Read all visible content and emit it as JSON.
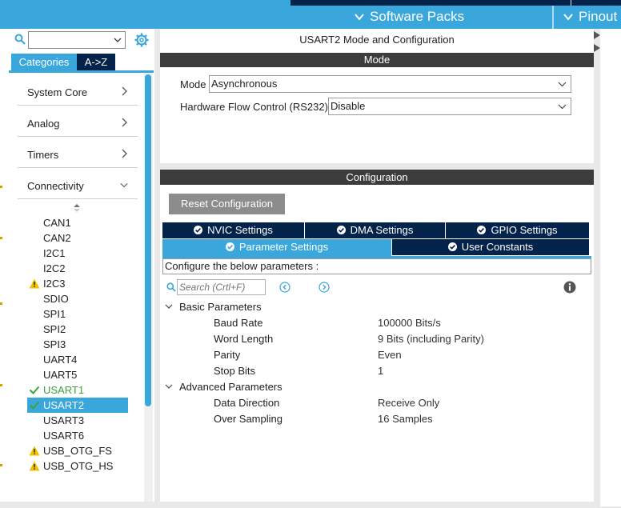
{
  "menubar": {
    "items": [
      {
        "label": "Software Packs"
      },
      {
        "label": "Pinout"
      }
    ]
  },
  "left": {
    "search": {
      "value": "",
      "placeholder": ""
    },
    "tabs": [
      {
        "label": "Categories"
      },
      {
        "label": "A->Z"
      }
    ],
    "categories": [
      {
        "label": "System Core",
        "state": "collapsed"
      },
      {
        "label": "Analog",
        "state": "collapsed"
      },
      {
        "label": "Timers",
        "state": "collapsed"
      },
      {
        "label": "Connectivity",
        "state": "expanded"
      }
    ],
    "peripherals": [
      {
        "label": "CAN1",
        "status": "none"
      },
      {
        "label": "CAN2",
        "status": "none"
      },
      {
        "label": "I2C1",
        "status": "none"
      },
      {
        "label": "I2C2",
        "status": "none"
      },
      {
        "label": "I2C3",
        "status": "warning"
      },
      {
        "label": "SDIO",
        "status": "none"
      },
      {
        "label": "SPI1",
        "status": "none"
      },
      {
        "label": "SPI2",
        "status": "none"
      },
      {
        "label": "SPI3",
        "status": "none"
      },
      {
        "label": "UART4",
        "status": "none"
      },
      {
        "label": "UART5",
        "status": "none"
      },
      {
        "label": "USART1",
        "status": "ok"
      },
      {
        "label": "USART2",
        "status": "selected"
      },
      {
        "label": "USART3",
        "status": "none"
      },
      {
        "label": "USART6",
        "status": "none"
      },
      {
        "label": "USB_OTG_FS",
        "status": "warning"
      },
      {
        "label": "USB_OTG_HS",
        "status": "warning"
      }
    ]
  },
  "mode": {
    "title": "USART2 Mode and Configuration",
    "header": "Mode",
    "mode_label": "Mode",
    "mode_value": "Asynchronous",
    "flow_label": "Hardware Flow Control (RS232)",
    "flow_value": "Disable"
  },
  "config": {
    "header": "Configuration",
    "reset_label": "Reset Configuration",
    "tabs": [
      {
        "label": "NVIC Settings"
      },
      {
        "label": "DMA Settings"
      },
      {
        "label": "GPIO Settings"
      },
      {
        "label": "Parameter Settings"
      },
      {
        "label": "User Constants"
      }
    ],
    "description": "Configure the below parameters :",
    "search_placeholder": "Search (Crtl+F)",
    "groups": [
      {
        "label": "Basic Parameters",
        "params": [
          {
            "name": "Baud Rate",
            "value": "100000 Bits/s"
          },
          {
            "name": "Word Length",
            "value": "9 Bits (including Parity)"
          },
          {
            "name": "Parity",
            "value": "Even"
          },
          {
            "name": "Stop Bits",
            "value": "1"
          }
        ]
      },
      {
        "label": "Advanced Parameters",
        "params": [
          {
            "name": "Data Direction",
            "value": "Receive Only"
          },
          {
            "name": "Over Sampling",
            "value": "16 Samples"
          }
        ]
      }
    ]
  },
  "colors": {
    "accent": "#39a6dc",
    "navy": "#03234b",
    "header_dark": "#3c3c3c",
    "ok_green": "#3ba33b",
    "warning_yellow": "#f2c200"
  }
}
